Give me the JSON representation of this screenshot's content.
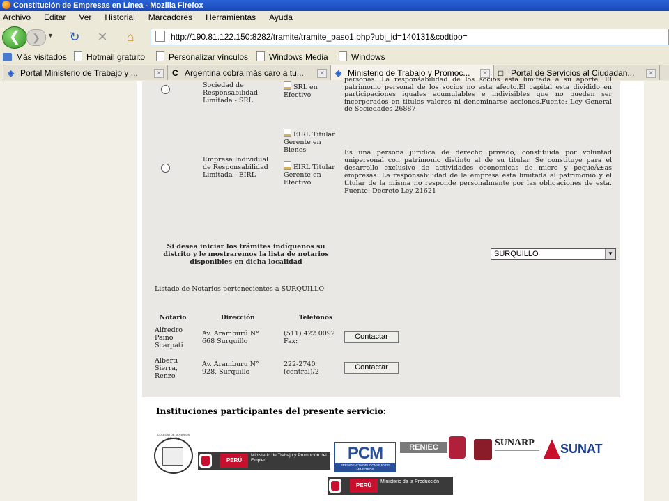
{
  "window": {
    "title": "Constitución de Empresas en Línea - Mozilla Firefox"
  },
  "menu": [
    "Archivo",
    "Editar",
    "Ver",
    "Historial",
    "Marcadores",
    "Herramientas",
    "Ayuda"
  ],
  "address": {
    "url": "http://190.81.122.150:8282/tramite/tramite_paso1.php?ubi_id=140131&codtipo="
  },
  "bookmarks": [
    "Más visitados",
    "Hotmail gratuito",
    "Personalizar vínculos",
    "Windows Media",
    "Windows"
  ],
  "tabs": [
    "Portal Ministerio de Trabajo y ...",
    "Argentina cobra más caro a tu...",
    "Ministerio de Trabajo y Promoc...",
    "Portal de Servicios al Ciudadan..."
  ],
  "company_types": [
    {
      "name": "Sociedad de Responsabilidad Limitada - SRL",
      "options": [
        "SRL en Efectivo"
      ],
      "description": "personas. La responsabilidad de los socios esta limitada a su aporte. El patrimonio personal de los socios no esta afecto.El capital esta dividido en participaciones iguales acumulables e indivisibles que no pueden ser incorporados en titulos valores ni denominarse acciones.Fuente: Ley General de Sociedades 26887"
    },
    {
      "name": "Empresa Individual de Responsabilidad Limitada - EIRL",
      "options": [
        "EIRL Titular Gerente en Bienes",
        "EIRL Titular Gerente en Efectivo"
      ],
      "description": "Es una persona juridica de derecho privado, constituida por voluntad unipersonal con patrimonio distinto al de su titular. Se constituye para el desarrollo exclusivo de actividades economicas de micro y pequeÃ±as empresas. La responsabilidad de la empresa esta limitada al patrimonio y el titular de la misma no responde personalmente por las obligaciones de esta. Fuente: Decreto Ley 21621"
    }
  ],
  "district": {
    "prompt": "Si desea iniciar los trámites indíquenos su distrito y le mostraremos la lista de notarios disponibles en dicha localidad",
    "selected": "SURQUILLO"
  },
  "notaries": {
    "heading": "Listado de Notarios pertenecientes a SURQUILLO",
    "columns": [
      "Notario",
      "Dirección",
      "Teléfonos"
    ],
    "rows": [
      {
        "name": "Alfredro Paino Scarpati",
        "address": "Av. Aramburú N° 668 Surquillo",
        "phone": "(511) 422 0092 Fax:",
        "action": "Contactar"
      },
      {
        "name": "Alberti Sierra, Renzo",
        "address": "Av. Aramburu N° 928, Surquillo",
        "phone": "222-2740 (central)/2",
        "action": "Contactar"
      }
    ]
  },
  "institutions": {
    "heading": "Instituciones participantes del presente servicio:",
    "logos": {
      "colegio": "COLEGIO DE NOTARIOS DE LIMA",
      "peru1": "PERÚ",
      "mintra": "Ministerio de Trabajo y Promoción del Empleo",
      "pcm": "PCM",
      "pcm_sub": "PRESIDENCIA DEL CONSEJO DE MINISTROS",
      "reniec": "RENIEC",
      "sunarp": "SUNARP",
      "sunat": "SUNAT",
      "peru2": "PERÚ",
      "produce": "Ministerio de la Producción"
    }
  }
}
